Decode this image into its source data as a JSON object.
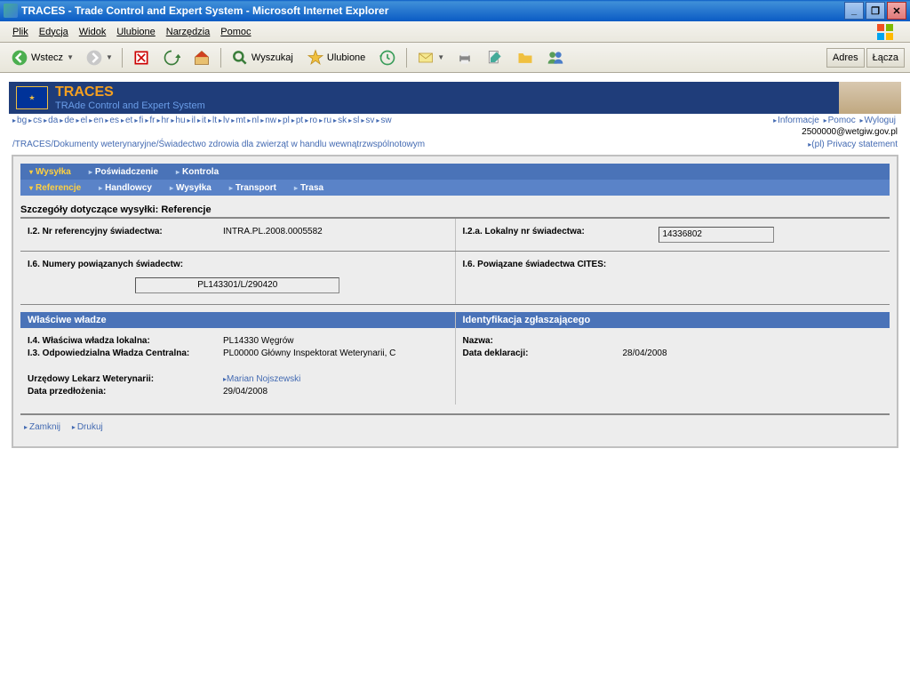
{
  "window": {
    "title": "TRACES - Trade Control and Expert System - Microsoft Internet Explorer"
  },
  "menubar": [
    "Plik",
    "Edycja",
    "Widok",
    "Ulubione",
    "Narzędzia",
    "Pomoc"
  ],
  "toolbar": {
    "back": "Wstecz",
    "search": "Wyszukaj",
    "fav": "Ulubione",
    "addr": "Adres",
    "links": "Łącza"
  },
  "traces": {
    "t1": "TRACES",
    "t2": "TRAde Control and Expert System"
  },
  "langs": [
    "bg",
    "cs",
    "da",
    "de",
    "el",
    "en",
    "es",
    "et",
    "fi",
    "fr",
    "hr",
    "hu",
    "il",
    "it",
    "lt",
    "lv",
    "mt",
    "nl",
    "nw",
    "pl",
    "pt",
    "ro",
    "ru",
    "sk",
    "sl",
    "sv",
    "sw"
  ],
  "toplinks": {
    "info": "Informacje",
    "help": "Pomoc",
    "logout": "Wyloguj"
  },
  "user_email": "2500000@wetgiw.gov.pl",
  "breadcrumb": {
    "root": "TRACES",
    "sep": "/",
    "l1": "Dokumenty weterynaryjne",
    "l2": "Świadectwo zdrowia dla zwierząt w handlu wewnątrzwspólnotowym",
    "privacy": "(pl) Privacy statement"
  },
  "tabs1": [
    {
      "label": "Wysyłka",
      "active": true
    },
    {
      "label": "Poświadczenie"
    },
    {
      "label": "Kontrola"
    }
  ],
  "tabs2": [
    {
      "label": "Referencje",
      "active": true
    },
    {
      "label": "Handlowcy"
    },
    {
      "label": "Wysyłka"
    },
    {
      "label": "Transport"
    },
    {
      "label": "Trasa"
    }
  ],
  "section_title": "Szczegóły dotyczące wysyłki: Referencje",
  "refs": {
    "l_i2": "I.2. Nr referencyjny świadectwa:",
    "v_i2": "INTRA.PL.2008.0005582",
    "l_i2a": "I.2.a. Lokalny nr świadectwa:",
    "v_i2a": "14336802",
    "l_i6": "I.6. Numery powiązanych świadectw:",
    "v_i6": "PL143301/L/290420",
    "l_i6b": "I.6. Powiązane świadectwa CITES:"
  },
  "auth_hdr": "Właściwe władze",
  "ident_hdr": "Identyfikacja zgłaszającego",
  "auth": {
    "l_i4": "I.4. Właściwa władza lokalna:",
    "v_i4": "PL14330 Węgrów",
    "l_i3": "I.3. Odpowiedzialna Władza Centralna:",
    "v_i3": "PL00000 Główny Inspektorat Weterynarii, C",
    "l_vet": "Urzędowy Lekarz Weterynarii:",
    "v_vet": "Marian  Nojszewski",
    "l_date": "Data przedłożenia:",
    "v_date": "29/04/2008"
  },
  "ident": {
    "l_name": "Nazwa:",
    "l_date": "Data deklaracji:",
    "v_date": "28/04/2008"
  },
  "bottom": {
    "close": "Zamknij",
    "print": "Drukuj"
  }
}
